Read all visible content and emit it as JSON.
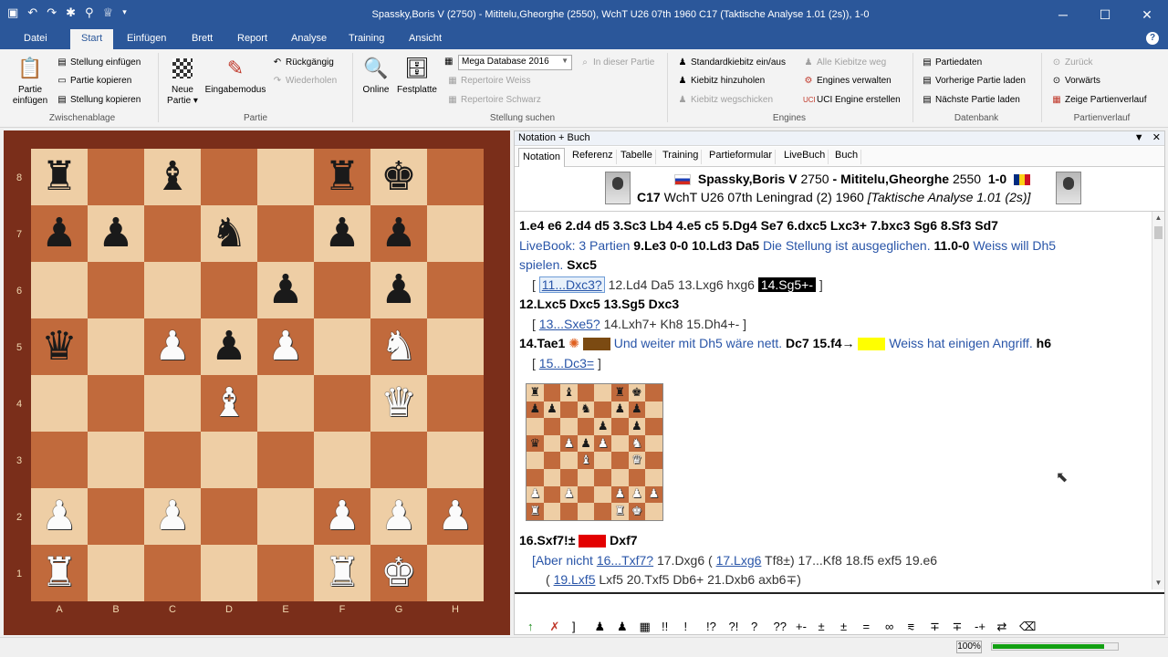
{
  "window": {
    "title": "Spassky,Boris V (2750) - Mititelu,Gheorghe (2550), WchT U26 07th 1960  C17  (Taktische Analyse 1.01 (2s)), 1-0"
  },
  "menu": {
    "file": "Datei",
    "tabs": [
      "Start",
      "Einfügen",
      "Brett",
      "Report",
      "Analyse",
      "Training",
      "Ansicht"
    ]
  },
  "ribbon": {
    "partie_einfuegen": "Partie einfügen",
    "stellung_einfuegen": "Stellung einfügen",
    "partie_kopieren": "Partie kopieren",
    "stellung_kopieren": "Stellung kopieren",
    "g_zwischenablage": "Zwischenablage",
    "neue_partie": "Neue Partie",
    "eingabemodus": "Eingabemodus",
    "rueckgaengig": "Rückgängig",
    "wiederholen": "Wiederholen",
    "g_partie": "Partie",
    "online": "Online",
    "festplatte": "Festplatte",
    "database": "Mega Database 2016",
    "in_dieser_partie": "In dieser Partie",
    "rep_weiss": "Repertoire Weiss",
    "rep_schwarz": "Repertoire Schwarz",
    "g_stellung": "Stellung suchen",
    "std_kiebitz": "Standardkiebitz ein/aus",
    "alle_kiebitze": "Alle Kiebitze weg",
    "kiebitz_hinzu": "Kiebitz hinzuholen",
    "engines_verwalten": "Engines verwalten",
    "kiebitz_weg": "Kiebitz wegschicken",
    "uci_engine": "UCI Engine erstellen",
    "g_engines": "Engines",
    "partiedaten": "Partiedaten",
    "vorherige": "Vorherige Partie laden",
    "naechste": "Nächste Partie laden",
    "g_datenbank": "Datenbank",
    "zurueck": "Zurück",
    "vorwaerts": "Vorwärts",
    "verlauf": "Zeige Partienverlauf",
    "g_verlauf": "Partienverlauf"
  },
  "board": {
    "ranks": [
      "8",
      "7",
      "6",
      "5",
      "4",
      "3",
      "2",
      "1"
    ],
    "files": [
      "A",
      "B",
      "C",
      "D",
      "E",
      "F",
      "G",
      "H"
    ],
    "rows": [
      [
        "br",
        "",
        "bb",
        "",
        "",
        "br",
        "bk",
        ""
      ],
      [
        "bp",
        "bp",
        "",
        "bn",
        "",
        "bp",
        "bp",
        ""
      ],
      [
        "",
        "",
        "",
        "",
        "bp",
        "",
        "bp",
        ""
      ],
      [
        "bq",
        "",
        "wp",
        "bp",
        "wp",
        "",
        "wn",
        ""
      ],
      [
        "",
        "",
        "",
        "wb",
        "",
        "",
        "wq",
        ""
      ],
      [
        "",
        "",
        "",
        "",
        "",
        "",
        "",
        ""
      ],
      [
        "wp",
        "",
        "wp",
        "",
        "",
        "wp",
        "wp",
        "wp"
      ],
      [
        "wr",
        "",
        "",
        "",
        "",
        "wr",
        "wk",
        ""
      ]
    ]
  },
  "panel": {
    "title": "Notation + Buch",
    "tabs": [
      "Notation",
      "Referenz",
      "Tabelle",
      "Training",
      "Partieformular",
      "LiveBuch",
      "Buch"
    ]
  },
  "game": {
    "white": "Spassky,Boris V",
    "white_elo": "2750",
    "black": "Mititelu,Gheorghe",
    "black_elo": "2550",
    "result": "1-0",
    "eco": "C17",
    "event": "WchT U26 07th Leningrad (2) 1960",
    "annotator": "[Taktische Analyse 1.01 (2s)]"
  },
  "notation": {
    "l1": "1.e4  e6  2.d4  d5  3.Sc3  Lb4  4.e5  c5  5.Dg4  Se7  6.dxc5  Lxc3+  7.bxc3  Sg6  8.Sf3  Sd7",
    "l2_book": "LiveBook: 3 Partien",
    "l2_moves": "9.Le3  0-0  10.Ld3  Da5",
    "l2_c1": "Die Stellung ist ausgeglichen.",
    "l2_m2": "11.0-0",
    "l2_c2": "Weiss will Dh5",
    "l3_c": "spielen.",
    "l3_m": "Sxc5",
    "v1a": "11...Dxc3?",
    "v1b": "12.Ld4  Da5  13.Lxg6  hxg6",
    "v1c": "14.Sg5+-",
    "l5": "12.Lxc5  Dxc5  13.Sg5  Dxc3",
    "v2a": "13...Sxe5?",
    "v2b": "14.Lxh7+  Kh8  15.Dh4+-",
    "l7_m1": "14.Tae1",
    "l7_c1": "Und weiter mit Dh5 wäre nett.",
    "l7_m2": "Dc7  15.f4→",
    "l7_c2": "Weiss hat einigen Angriff.",
    "l7_m3": "h6",
    "v3": "15...Dc3=",
    "l9_m1": "16.Sxf7!±",
    "l9_m2": "Dxf7",
    "l10_a": "[Aber nicht",
    "l10_b": "16...Txf7?",
    "l10_c": "17.Dxg6  (",
    "l10_d": "17.Lxg6",
    "l10_e": "Tf8±) 17...Kf8  18.f5  exf5  19.e6",
    "l11_a": "(",
    "l11_b": "19.Lxf5",
    "l11_c": "Lxf5  20.Txf5  Db6+  21.Dxb6  axb6∓)"
  },
  "colors": {
    "brown": "#7b4a12",
    "yellow": "#ffff00",
    "red": "#e30000"
  },
  "annotations": [
    "↑",
    "✗",
    "]",
    "♟",
    "♟",
    "▦",
    "!!",
    "!",
    "!?",
    "?!",
    "?",
    "??",
    "+-",
    "±",
    "±",
    "=",
    "∞",
    "⩳",
    "∓",
    "∓",
    "-+",
    "⇄",
    "⌫"
  ],
  "status": {
    "zoom": "100%"
  }
}
